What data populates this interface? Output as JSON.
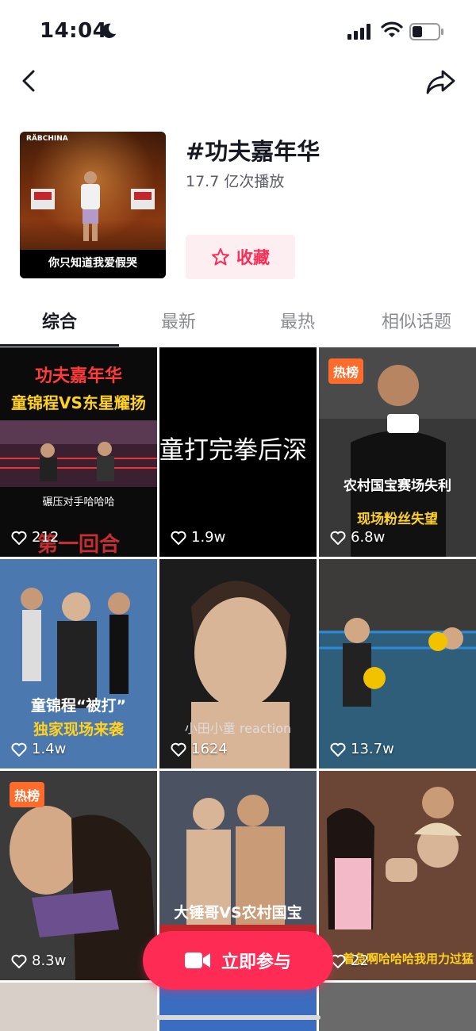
{
  "status": {
    "time": "14:04"
  },
  "topic": {
    "title": "#功夫嘉年华",
    "plays": "17.7 亿次播放",
    "favorite_label": "收藏",
    "cover_brand": "RÄBCHINA",
    "cover_caption": "你只知道我爱假哭"
  },
  "tabs": [
    "综合",
    "最新",
    "最热",
    "相似话题"
  ],
  "videos": [
    {
      "likes": "212",
      "title": "功夫嘉年华",
      "subtitle": "童锦程VS东星耀扬",
      "caption": "碾压对手哈哈哈",
      "overlay": "第一回合"
    },
    {
      "likes": "1.9w",
      "overlay": "童打完拳后深"
    },
    {
      "likes": "6.8w",
      "badge": "热榜",
      "title": "农村国宝赛场失利",
      "subtitle": "现场粉丝失望"
    },
    {
      "likes": "1.4w",
      "title": "童锦程“被打”",
      "subtitle": "独家现场来袭"
    },
    {
      "likes": "1624",
      "overlay": "小田小童 reaction"
    },
    {
      "likes": "13.7w"
    },
    {
      "likes": "8.3w",
      "badge": "热榜"
    },
    {
      "likes": "",
      "title": "大锤哥VS农村国宝"
    },
    {
      "likes": "22",
      "caption": "着急啊哈哈哈我用力过猛"
    }
  ],
  "join_label": "立即参与",
  "colors": {
    "accent": "#fe2c55",
    "hot_badge": "#fe6c2c"
  }
}
